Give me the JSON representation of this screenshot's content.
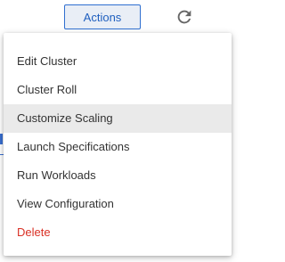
{
  "toolbar": {
    "actions_label": "Actions",
    "refresh_icon": "refresh-icon"
  },
  "menu": {
    "items": [
      {
        "label": "Edit Cluster",
        "highlighted": false,
        "danger": false
      },
      {
        "label": "Cluster Roll",
        "highlighted": false,
        "danger": false
      },
      {
        "label": "Customize Scaling",
        "highlighted": true,
        "danger": false
      },
      {
        "label": "Launch Specifications",
        "highlighted": false,
        "danger": false
      },
      {
        "label": "Run Workloads",
        "highlighted": false,
        "danger": false
      },
      {
        "label": "View Configuration",
        "highlighted": false,
        "danger": false
      },
      {
        "label": "Delete",
        "highlighted": false,
        "danger": true
      }
    ]
  },
  "colors": {
    "accent": "#2f6fd0",
    "danger": "#d93025",
    "hover": "#eaeaea"
  }
}
